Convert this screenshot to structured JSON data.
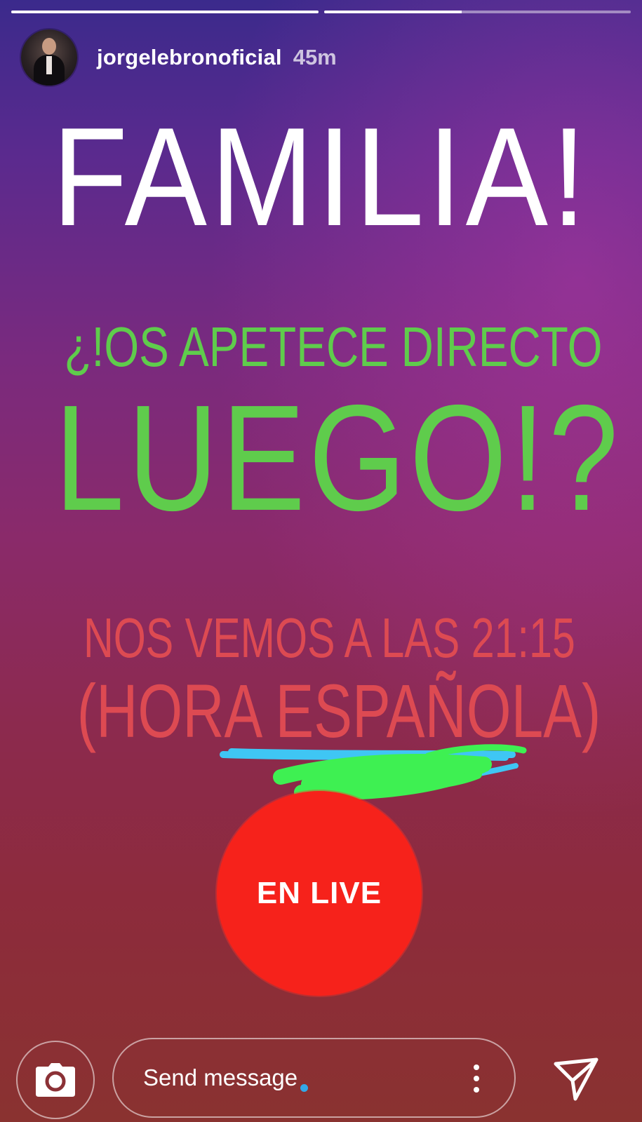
{
  "story": {
    "progress": [
      1.0,
      0.45
    ]
  },
  "header": {
    "username": "jorgelebronoficial",
    "time": "45m",
    "avatar_icon": "profile-photo"
  },
  "content": {
    "line1": "FAMILIA!",
    "line2": "¿!OS APETECE DIRECTO",
    "line3": "LUEGO!?",
    "line4": "NOS VEMOS A LAS 21:15",
    "line5": "(HORA ESPAÑOLA)",
    "colors": {
      "line1": "#ffffff",
      "question": "#5fcc4c",
      "schedule": "#dd4a52"
    }
  },
  "live_badge": {
    "label": "EN LIVE",
    "color": "#f6221b"
  },
  "bottom_bar": {
    "camera_icon": "camera-icon",
    "message_placeholder": "Send message",
    "more_icon": "more-vertical-icon",
    "send_icon": "send-icon"
  }
}
